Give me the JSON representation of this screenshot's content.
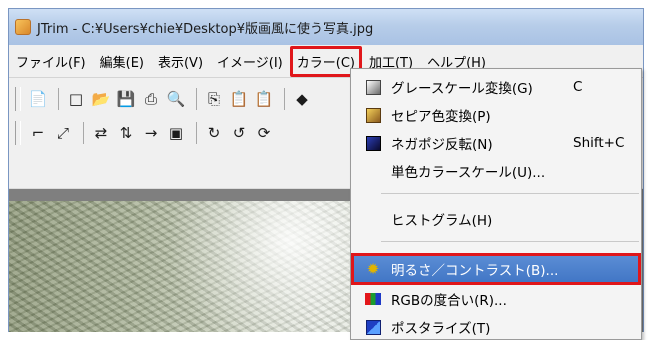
{
  "window": {
    "title": "JTrim - C:¥Users¥chie¥Desktop¥版画風に使う写真.jpg"
  },
  "menubar": [
    {
      "id": "file",
      "label": "ファイル(F)"
    },
    {
      "id": "edit",
      "label": "編集(E)"
    },
    {
      "id": "view",
      "label": "表示(V)"
    },
    {
      "id": "image",
      "label": "イメージ(I)"
    },
    {
      "id": "color",
      "label": "カラー(C)",
      "active": true
    },
    {
      "id": "process",
      "label": "加工(T)"
    },
    {
      "id": "help",
      "label": "ヘルプ(H)"
    }
  ],
  "toolbar": {
    "row1": [
      "new-file-icon",
      "new-icon",
      "open-icon",
      "save-icon",
      "print-icon",
      "print-preview-icon",
      "copy-icon",
      "paste-icon",
      "paste-special-icon",
      "color-picker-icon"
    ],
    "row2": [
      "crop-icon",
      "resize-icon",
      "flip-horizontal-icon",
      "flip-vertical-icon",
      "arrow-icon",
      "square-icon",
      "rotate-90-icon",
      "rotate-90-ccw-icon",
      "rotate-icon"
    ]
  },
  "color_menu": {
    "items": [
      {
        "label": "グレースケール変換(G)",
        "shortcut": "C",
        "icon": "grayscale-icon"
      },
      {
        "label": "セピア色変換(P)",
        "shortcut": "",
        "icon": "sepia-icon"
      },
      {
        "label": "ネガポジ反転(N)",
        "shortcut": "Shift+C",
        "icon": "negative-icon"
      },
      {
        "label": "単色カラースケール(U)...",
        "shortcut": "",
        "icon": ""
      },
      {
        "label": "ヒストグラム(H)",
        "shortcut": "",
        "icon": ""
      },
      {
        "label": "明るさ／コントラスト(B)...",
        "shortcut": "",
        "icon": "brightness-icon",
        "highlighted": true
      },
      {
        "label": "RGBの度合い(R)...",
        "shortcut": "",
        "icon": "rgb-icon"
      },
      {
        "label": "ポスタライズ(T)",
        "shortcut": "",
        "icon": "posterize-icon"
      }
    ]
  },
  "colors": {
    "highlight_outline": "#e0161a",
    "menu_highlight": "#4677c7",
    "titlebar": "#b7cde9"
  }
}
